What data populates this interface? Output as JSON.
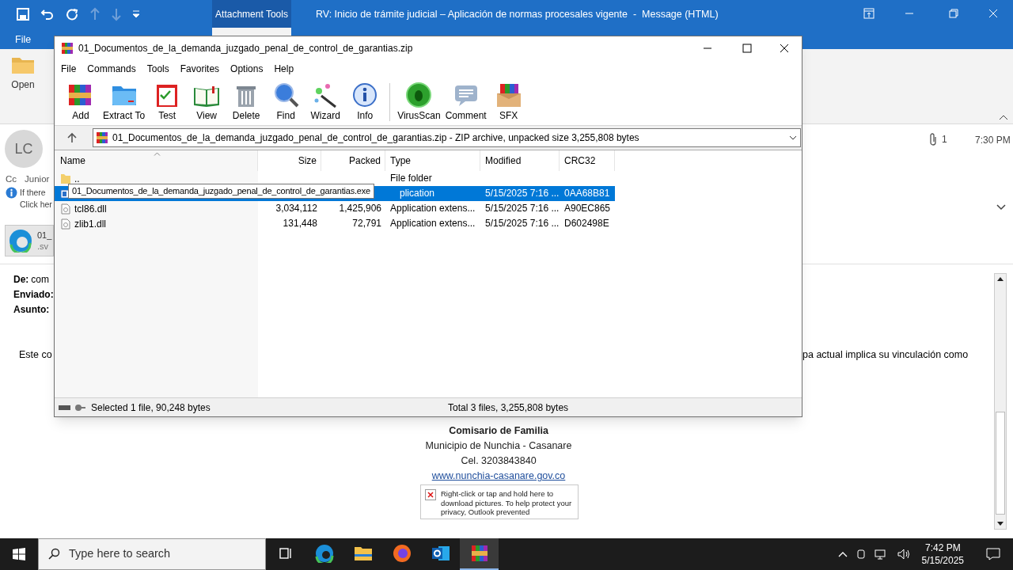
{
  "outlook": {
    "context_tab": "Attachment Tools",
    "title": "RV: Inicio de trámite judicial – Aplicación de normas procesales vigente  -  Message (HTML)",
    "file_tab": "File",
    "ribbon_open": "Open",
    "avatar": "LC",
    "cc_label": "Cc",
    "cc_value": "Junior",
    "info_line1": "If there",
    "info_line2": "Click her",
    "attachment_name": "01_",
    "attachment_ext": ".sv",
    "attachment_count": "1",
    "time": "7:30 PM",
    "header_fields": [
      {
        "label": "De:",
        "value": "com"
      },
      {
        "label": "Enviado:"
      },
      {
        "label": "Asunto:"
      }
    ],
    "body_left": "Este co",
    "body_right": "pa actual implica su vinculación como",
    "signature": [
      {
        "text": "Comisario de Familia",
        "kind": "bold"
      },
      {
        "text": "Municipio de Nunchia - Casanare",
        "kind": "plain"
      },
      {
        "text": "Cel. 3203843840",
        "kind": "plain"
      },
      {
        "text": "www.nunchia-casanare.gov.co",
        "kind": "link"
      }
    ],
    "blocked_image_text": "Right-click or tap and hold here to download pictures. To help protect your privacy, Outlook prevented"
  },
  "winrar": {
    "title": "01_Documentos_de_la_demanda_juzgado_penal_de_control_de_garantias.zip",
    "menu": [
      "File",
      "Commands",
      "Tools",
      "Favorites",
      "Options",
      "Help"
    ],
    "toolbar": [
      {
        "label": "Add",
        "kind": "add"
      },
      {
        "label": "Extract To",
        "kind": "extract"
      },
      {
        "label": "Test",
        "kind": "test"
      },
      {
        "label": "View",
        "kind": "view"
      },
      {
        "label": "Delete",
        "kind": "delete"
      },
      {
        "label": "Find",
        "kind": "find"
      },
      {
        "label": "Wizard",
        "kind": "wizard"
      },
      {
        "label": "Info",
        "kind": "info"
      },
      {
        "label": "VirusScan",
        "kind": "virus"
      },
      {
        "label": "Comment",
        "kind": "comment"
      },
      {
        "label": "SFX",
        "kind": "sfx"
      }
    ],
    "address": "01_Documentos_de_la_demanda_juzgado_penal_de_control_de_garantias.zip - ZIP archive, unpacked size 3,255,808 bytes",
    "columns": [
      "Name",
      "Size",
      "Packed",
      "Type",
      "Modified",
      "CRC32"
    ],
    "rows": [
      {
        "kind": "folder",
        "selected": false,
        "name": "..",
        "size": "",
        "packed": "",
        "type": "File folder",
        "modified": "",
        "crc": ""
      },
      {
        "kind": "exe",
        "selected": true,
        "name": "",
        "size": "",
        "packed": "",
        "type": "plication",
        "modified": "5/15/2025 7:16 ...",
        "crc": "0AA68B81",
        "tooltip": "01_Documentos_de_la_demanda_juzgado_penal_de_control_de_garantias.exe"
      },
      {
        "kind": "dll",
        "selected": false,
        "name": "tcl86.dll",
        "size": "3,034,112",
        "packed": "1,425,906",
        "type": "Application extens...",
        "modified": "5/15/2025 7:16 ...",
        "crc": "A90EC865"
      },
      {
        "kind": "dll",
        "selected": false,
        "name": "zlib1.dll",
        "size": "131,448",
        "packed": "72,791",
        "type": "Application extens...",
        "modified": "5/15/2025 7:16 ...",
        "crc": "D602498E"
      }
    ],
    "status_left": "Selected 1 file, 90,248 bytes",
    "status_right": "Total 3 files, 3,255,808 bytes"
  },
  "taskbar": {
    "search_placeholder": "Type here to search",
    "apps": [
      {
        "kind": "taskview",
        "selected": false
      },
      {
        "kind": "edge",
        "selected": false
      },
      {
        "kind": "explorer",
        "selected": false
      },
      {
        "kind": "firefox",
        "selected": false
      },
      {
        "kind": "outlook",
        "selected": false
      },
      {
        "kind": "winrar",
        "selected": true
      }
    ],
    "time": "7:42 PM",
    "date": "5/15/2025"
  }
}
